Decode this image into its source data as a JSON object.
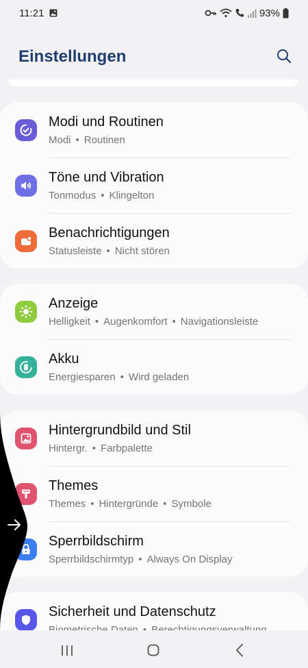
{
  "status_bar": {
    "time": "11:21",
    "battery": "93%"
  },
  "header": {
    "title": "Einstellungen"
  },
  "colors": {
    "title": "#1f3d6e",
    "modi": "#6a5cd6",
    "toene": "#6e6fe4",
    "benachrichtigungen": "#ee6c3a",
    "anzeige": "#8fcb3e",
    "akku": "#37b29a",
    "hintergrund": "#e0536f",
    "themes": "#e0536f",
    "sperrbildschirm": "#3b7ef0",
    "sicherheit": "#5857ea"
  },
  "groups": [
    {
      "items": [
        {
          "title": "Modi und Routinen",
          "sub": [
            "Modi",
            "Routinen"
          ],
          "icon": "modes-icon"
        },
        {
          "title": "Töne und Vibration",
          "sub": [
            "Tonmodus",
            "Klingelton"
          ],
          "icon": "sound-icon"
        },
        {
          "title": "Benachrichtigungen",
          "sub": [
            "Statusleiste",
            "Nicht stören"
          ],
          "icon": "notification-icon"
        }
      ]
    },
    {
      "items": [
        {
          "title": "Anzeige",
          "sub": [
            "Helligkeit",
            "Augenkomfort",
            "Navigationsleiste"
          ],
          "icon": "brightness-icon"
        },
        {
          "title": "Akku",
          "sub": [
            "Energiesparen",
            "Wird geladen"
          ],
          "icon": "battery-icon"
        }
      ]
    },
    {
      "items": [
        {
          "title": "Hintergrundbild und Stil",
          "sub": [
            "Hintergr.",
            "Farbpalette"
          ],
          "icon": "wallpaper-icon"
        },
        {
          "title": "Themes",
          "sub": [
            "Themes",
            "Hintergründe",
            "Symbole"
          ],
          "icon": "themes-icon"
        },
        {
          "title": "Sperrbildschirm",
          "sub": [
            "Sperrbildschirmtyp",
            "Always On Display"
          ],
          "icon": "lock-icon"
        }
      ]
    },
    {
      "items": [
        {
          "title": "Sicherheit und Datenschutz",
          "sub": [
            "Biometrische Daten",
            "Berechtigungsverwaltung"
          ],
          "icon": "shield-icon"
        }
      ]
    }
  ]
}
